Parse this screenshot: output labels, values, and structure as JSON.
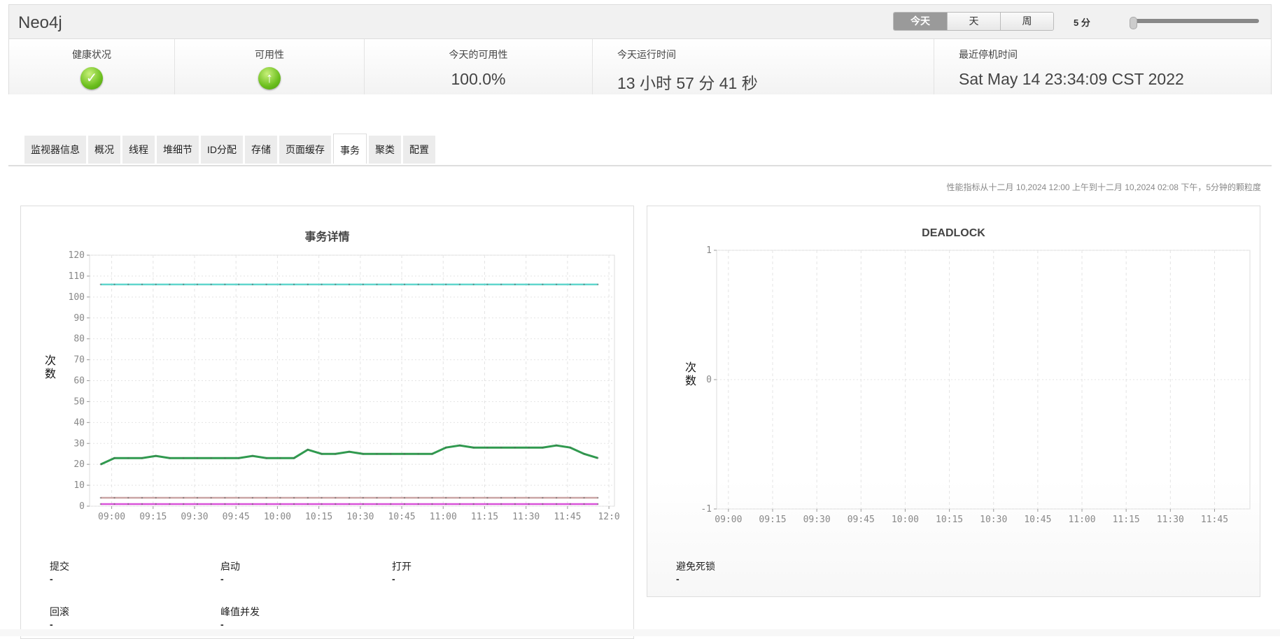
{
  "header": {
    "title": "Neo4j",
    "range_buttons": [
      "今天",
      "天",
      "周"
    ],
    "granularity": "5 分"
  },
  "stats": [
    {
      "label": "健康状况",
      "icon": "check-icon"
    },
    {
      "label": "可用性",
      "icon": "up-arrow-icon"
    },
    {
      "label": "今天的可用性",
      "value": "100.0%"
    },
    {
      "label": "今天运行时间",
      "value": "13 小时 57 分 41 秒"
    },
    {
      "label": "最近停机时间",
      "value": "Sat May 14 23:34:09 CST 2022"
    }
  ],
  "tabs": [
    "监视器信息",
    "概况",
    "线程",
    "堆细节",
    "ID分配",
    "存储",
    "页面缓存",
    "事务",
    "聚类",
    "配置"
  ],
  "active_tab": "事务",
  "subtitle": "性能指标从十二月 10,2024 12:00 上午到十二月 10,2024 02:08 下午，5分钟的颗粒度",
  "chart_data": [
    {
      "type": "line",
      "title": "事务详情",
      "ylabel": "次数",
      "ylim": [
        0,
        120
      ],
      "yticks": [
        0,
        10,
        20,
        30,
        40,
        50,
        60,
        70,
        80,
        90,
        100,
        110,
        120
      ],
      "xlim": [
        "08:52",
        "12:02"
      ],
      "xticks": [
        "09:00",
        "09:15",
        "09:30",
        "09:45",
        "10:00",
        "10:15",
        "10:30",
        "10:45",
        "11:00",
        "11:15",
        "11:30",
        "11:45",
        "12:0"
      ],
      "x_start": "08:56",
      "x_step_min": 5,
      "series": [
        {
          "name": "series-cyan",
          "color": "#4fd0c8",
          "values": [
            106,
            106,
            106,
            106,
            106,
            106,
            106,
            106,
            106,
            106,
            106,
            106,
            106,
            106,
            106,
            106,
            106,
            106,
            106,
            106,
            106,
            106,
            106,
            106,
            106,
            106,
            106,
            106,
            106,
            106,
            106,
            106,
            106,
            106,
            106,
            106,
            106
          ]
        },
        {
          "name": "series-green",
          "color": "#1a8f3c",
          "values": [
            20,
            23,
            23,
            23,
            24,
            23,
            23,
            23,
            23,
            23,
            23,
            24,
            23,
            23,
            23,
            27,
            25,
            25,
            26,
            25,
            25,
            25,
            25,
            25,
            25,
            28,
            29,
            28,
            28,
            28,
            28,
            28,
            28,
            29,
            28,
            25,
            23
          ]
        },
        {
          "name": "series-brown",
          "color": "#c49a9a",
          "values": [
            4,
            4,
            4,
            4,
            4,
            4,
            4,
            4,
            4,
            4,
            4,
            4,
            4,
            4,
            4,
            4,
            4,
            4,
            4,
            4,
            4,
            4,
            4,
            4,
            4,
            4,
            4,
            4,
            4,
            4,
            4,
            4,
            4,
            4,
            4,
            4,
            4
          ]
        },
        {
          "name": "series-magenta",
          "color": "#d43fd4",
          "values": [
            1,
            1,
            1,
            1,
            1,
            1,
            1,
            1,
            1,
            1,
            1,
            1,
            1,
            1,
            1,
            1,
            1,
            1,
            1,
            1,
            1,
            1,
            1,
            1,
            1,
            1,
            1,
            1,
            1,
            1,
            1,
            1,
            1,
            1,
            1,
            1,
            1
          ]
        }
      ],
      "legend": [
        {
          "label": "提交",
          "value": "-"
        },
        {
          "label": "启动",
          "value": "-"
        },
        {
          "label": "打开",
          "value": "-"
        },
        {
          "label": "回滚",
          "value": "-"
        },
        {
          "label": "峰值并发",
          "value": "-"
        }
      ]
    },
    {
      "type": "line",
      "title": "DEADLOCK",
      "ylabel": "次数",
      "ylim": [
        -1,
        1
      ],
      "yticks": [
        -1,
        0,
        1
      ],
      "xlim": [
        "08:56",
        "11:57"
      ],
      "xticks": [
        "09:00",
        "09:15",
        "09:30",
        "09:45",
        "10:00",
        "10:15",
        "10:30",
        "10:45",
        "11:00",
        "11:15",
        "11:30",
        "11:45"
      ],
      "series": [],
      "legend": [
        {
          "label": "避免死锁",
          "value": "-"
        }
      ]
    }
  ]
}
